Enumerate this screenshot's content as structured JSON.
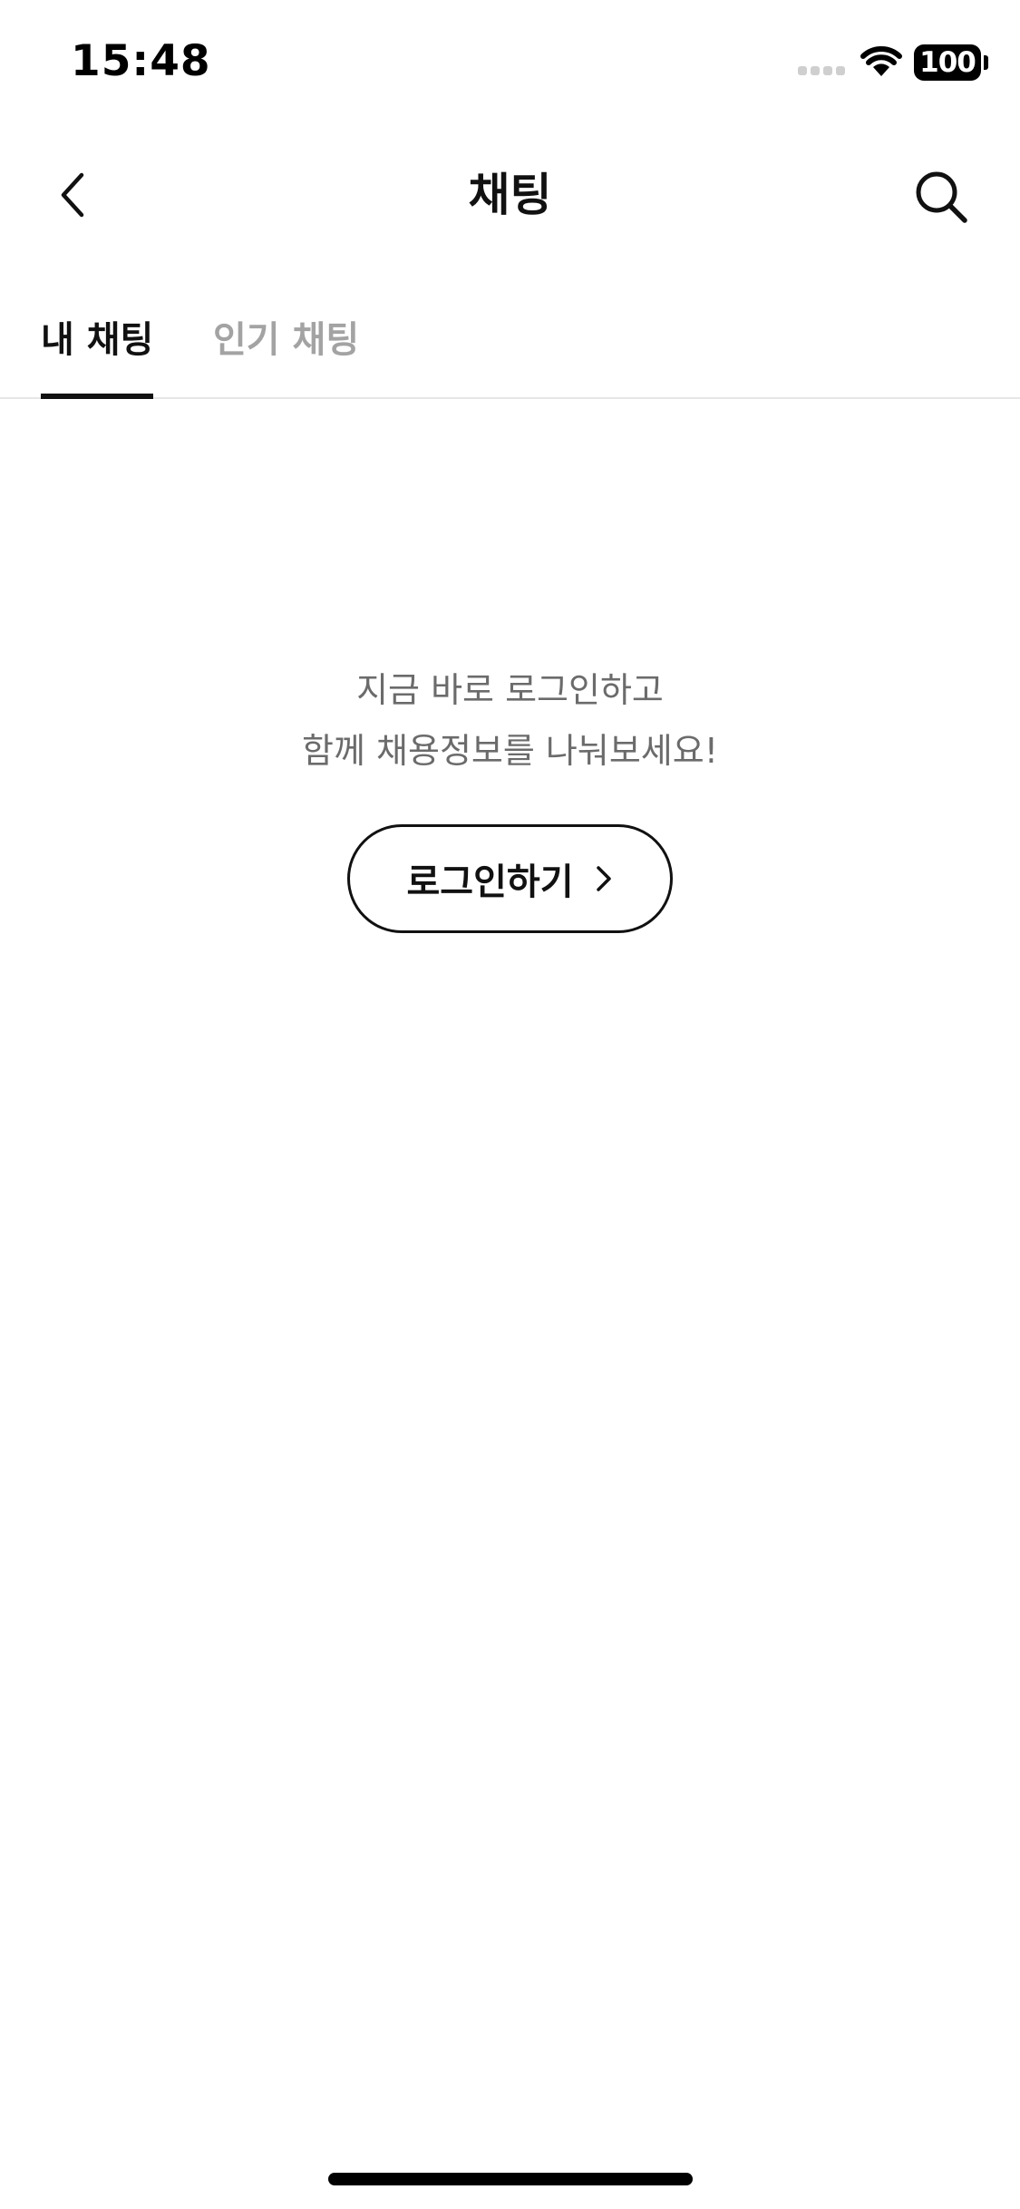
{
  "status_bar": {
    "time": "15:48",
    "battery_level": "100"
  },
  "header": {
    "title": "채팅",
    "back_icon": "chevron-left-icon",
    "search_icon": "search-icon"
  },
  "tabs": [
    {
      "label": "내 채팅",
      "active": true
    },
    {
      "label": "인기 채팅",
      "active": false
    }
  ],
  "empty_state": {
    "line1": "지금 바로 로그인하고",
    "line2": "함께 채용정보를 나눠보세요!",
    "login_label": "로그인하기",
    "login_icon": "chevron-right-icon"
  },
  "colors": {
    "text_primary": "#111111",
    "text_inactive": "#a3a3a3",
    "text_secondary": "#6b6b6b",
    "divider": "#e6e6e6"
  }
}
